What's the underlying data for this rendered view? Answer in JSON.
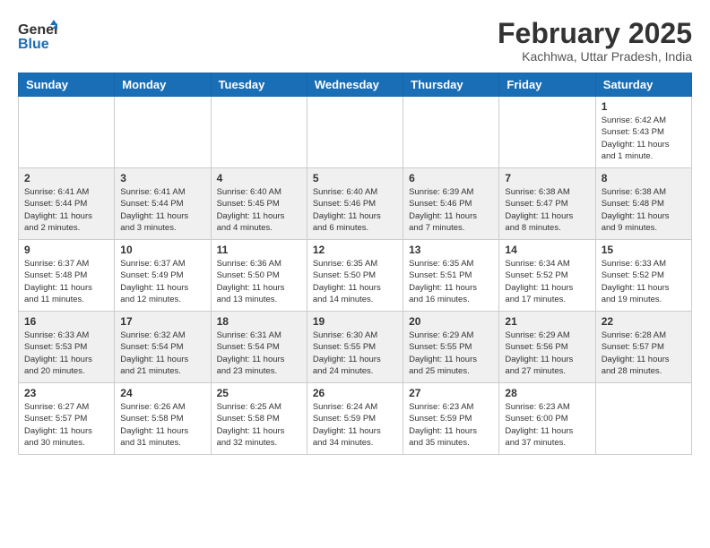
{
  "header": {
    "logo_general": "General",
    "logo_blue": "Blue",
    "month": "February 2025",
    "location": "Kachhwa, Uttar Pradesh, India"
  },
  "weekdays": [
    "Sunday",
    "Monday",
    "Tuesday",
    "Wednesday",
    "Thursday",
    "Friday",
    "Saturday"
  ],
  "weeks": [
    [
      {
        "day": "",
        "info": ""
      },
      {
        "day": "",
        "info": ""
      },
      {
        "day": "",
        "info": ""
      },
      {
        "day": "",
        "info": ""
      },
      {
        "day": "",
        "info": ""
      },
      {
        "day": "",
        "info": ""
      },
      {
        "day": "1",
        "info": "Sunrise: 6:42 AM\nSunset: 5:43 PM\nDaylight: 11 hours\nand 1 minute."
      }
    ],
    [
      {
        "day": "2",
        "info": "Sunrise: 6:41 AM\nSunset: 5:44 PM\nDaylight: 11 hours\nand 2 minutes."
      },
      {
        "day": "3",
        "info": "Sunrise: 6:41 AM\nSunset: 5:44 PM\nDaylight: 11 hours\nand 3 minutes."
      },
      {
        "day": "4",
        "info": "Sunrise: 6:40 AM\nSunset: 5:45 PM\nDaylight: 11 hours\nand 4 minutes."
      },
      {
        "day": "5",
        "info": "Sunrise: 6:40 AM\nSunset: 5:46 PM\nDaylight: 11 hours\nand 6 minutes."
      },
      {
        "day": "6",
        "info": "Sunrise: 6:39 AM\nSunset: 5:46 PM\nDaylight: 11 hours\nand 7 minutes."
      },
      {
        "day": "7",
        "info": "Sunrise: 6:38 AM\nSunset: 5:47 PM\nDaylight: 11 hours\nand 8 minutes."
      },
      {
        "day": "8",
        "info": "Sunrise: 6:38 AM\nSunset: 5:48 PM\nDaylight: 11 hours\nand 9 minutes."
      }
    ],
    [
      {
        "day": "9",
        "info": "Sunrise: 6:37 AM\nSunset: 5:48 PM\nDaylight: 11 hours\nand 11 minutes."
      },
      {
        "day": "10",
        "info": "Sunrise: 6:37 AM\nSunset: 5:49 PM\nDaylight: 11 hours\nand 12 minutes."
      },
      {
        "day": "11",
        "info": "Sunrise: 6:36 AM\nSunset: 5:50 PM\nDaylight: 11 hours\nand 13 minutes."
      },
      {
        "day": "12",
        "info": "Sunrise: 6:35 AM\nSunset: 5:50 PM\nDaylight: 11 hours\nand 14 minutes."
      },
      {
        "day": "13",
        "info": "Sunrise: 6:35 AM\nSunset: 5:51 PM\nDaylight: 11 hours\nand 16 minutes."
      },
      {
        "day": "14",
        "info": "Sunrise: 6:34 AM\nSunset: 5:52 PM\nDaylight: 11 hours\nand 17 minutes."
      },
      {
        "day": "15",
        "info": "Sunrise: 6:33 AM\nSunset: 5:52 PM\nDaylight: 11 hours\nand 19 minutes."
      }
    ],
    [
      {
        "day": "16",
        "info": "Sunrise: 6:33 AM\nSunset: 5:53 PM\nDaylight: 11 hours\nand 20 minutes."
      },
      {
        "day": "17",
        "info": "Sunrise: 6:32 AM\nSunset: 5:54 PM\nDaylight: 11 hours\nand 21 minutes."
      },
      {
        "day": "18",
        "info": "Sunrise: 6:31 AM\nSunset: 5:54 PM\nDaylight: 11 hours\nand 23 minutes."
      },
      {
        "day": "19",
        "info": "Sunrise: 6:30 AM\nSunset: 5:55 PM\nDaylight: 11 hours\nand 24 minutes."
      },
      {
        "day": "20",
        "info": "Sunrise: 6:29 AM\nSunset: 5:55 PM\nDaylight: 11 hours\nand 25 minutes."
      },
      {
        "day": "21",
        "info": "Sunrise: 6:29 AM\nSunset: 5:56 PM\nDaylight: 11 hours\nand 27 minutes."
      },
      {
        "day": "22",
        "info": "Sunrise: 6:28 AM\nSunset: 5:57 PM\nDaylight: 11 hours\nand 28 minutes."
      }
    ],
    [
      {
        "day": "23",
        "info": "Sunrise: 6:27 AM\nSunset: 5:57 PM\nDaylight: 11 hours\nand 30 minutes."
      },
      {
        "day": "24",
        "info": "Sunrise: 6:26 AM\nSunset: 5:58 PM\nDaylight: 11 hours\nand 31 minutes."
      },
      {
        "day": "25",
        "info": "Sunrise: 6:25 AM\nSunset: 5:58 PM\nDaylight: 11 hours\nand 32 minutes."
      },
      {
        "day": "26",
        "info": "Sunrise: 6:24 AM\nSunset: 5:59 PM\nDaylight: 11 hours\nand 34 minutes."
      },
      {
        "day": "27",
        "info": "Sunrise: 6:23 AM\nSunset: 5:59 PM\nDaylight: 11 hours\nand 35 minutes."
      },
      {
        "day": "28",
        "info": "Sunrise: 6:23 AM\nSunset: 6:00 PM\nDaylight: 11 hours\nand 37 minutes."
      },
      {
        "day": "",
        "info": ""
      }
    ]
  ]
}
